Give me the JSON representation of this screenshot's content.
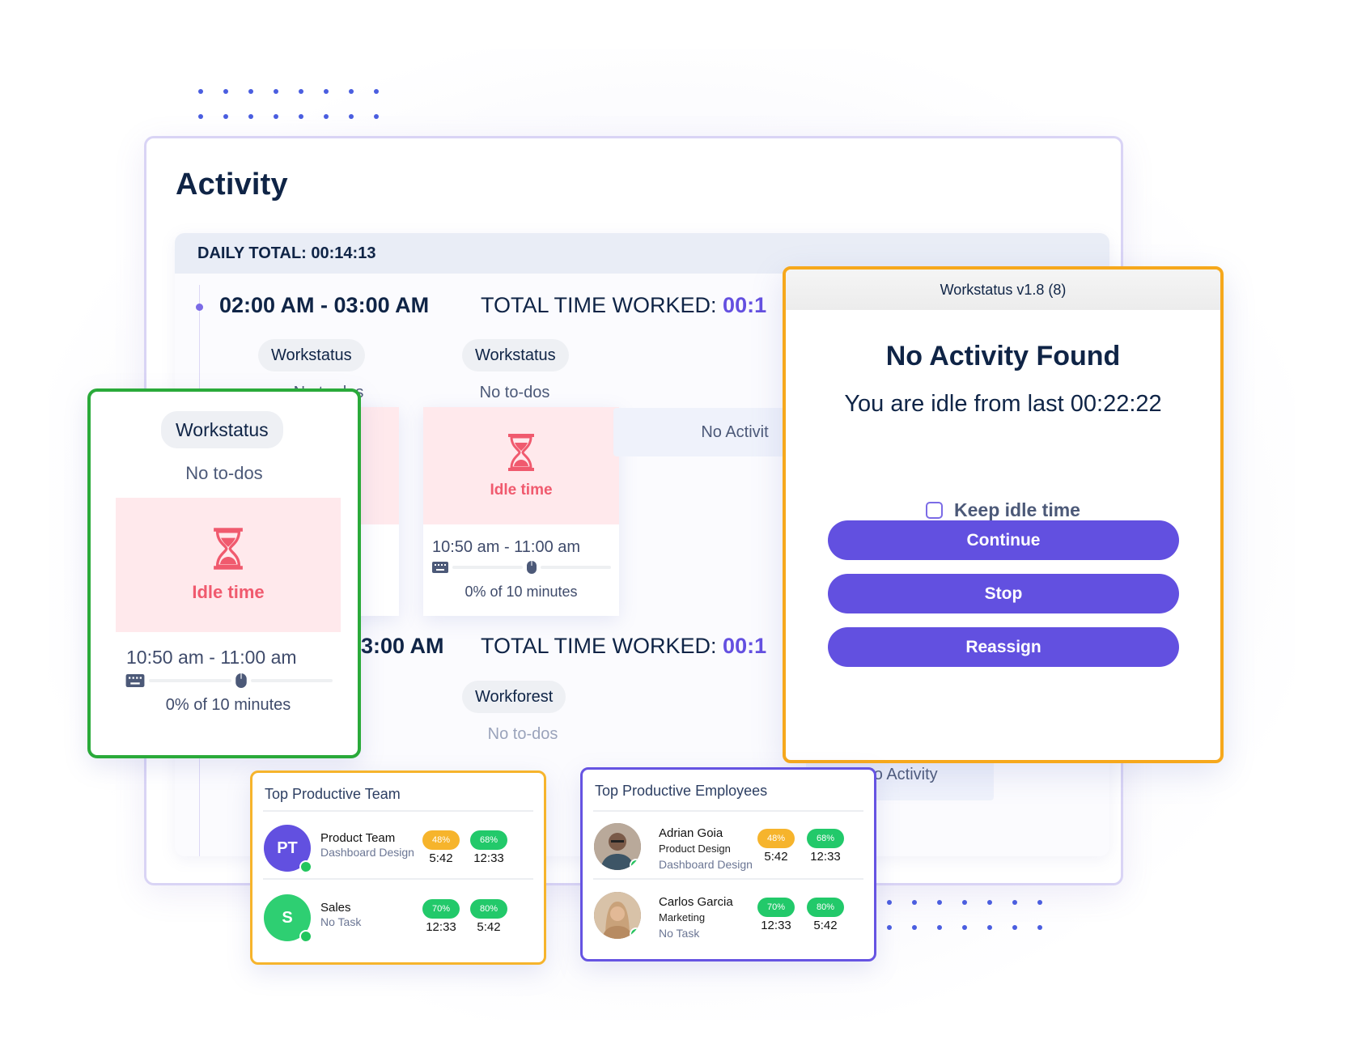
{
  "page": {
    "title": "Activity",
    "daily_total": "DAILY TOTAL: 00:14:13"
  },
  "hours": [
    {
      "range": "02:00 AM - 03:00 AM",
      "total_label": "TOTAL TIME WORKED:",
      "total_value": "00:1",
      "slots": [
        {
          "app": "Workstatus",
          "todos": "No to-dos",
          "status": "Idle time",
          "time": "10:50 am - 11:00 am",
          "activity_pct": "0% of 10 minutes"
        },
        {
          "app": "Workstatus",
          "todos": "No to-dos",
          "status": "Idle time",
          "time": "10:50 am - 11:00 am",
          "activity_pct": "0% of 10 minutes"
        },
        {
          "status": "No Activit"
        }
      ]
    },
    {
      "range": "3:00 AM",
      "total_label": "TOTAL TIME WORKED:",
      "total_value": "00:1",
      "slots": [
        {
          "app": "Workforest",
          "todos": "No to-dos"
        },
        {
          "status": "No Activity"
        }
      ]
    }
  ],
  "highlight_card": {
    "app": "Workstatus",
    "todos": "No to-dos",
    "status": "Idle time",
    "time": "10:50 am - 11:00 am",
    "activity_pct": "0% of 10 minutes",
    "keyboard_activity": 0,
    "mouse_activity": 0
  },
  "idle_dialog": {
    "window_title": "Workstatus v1.8 (8)",
    "heading": "No Activity Found",
    "message": "You are idle from last 00:22:22",
    "keep_idle_label": "Keep idle time",
    "keep_idle_checked": false,
    "buttons": {
      "continue": "Continue",
      "stop": "Stop",
      "reassign": "Reassign"
    }
  },
  "top_team": {
    "title": "Top Productive Team",
    "rows": [
      {
        "initials": "PT",
        "name": "Product Team",
        "task": "Dashboard Design",
        "online": true,
        "metrics": [
          {
            "badge": "48%",
            "value": "5:42",
            "color": "#f6b42c"
          },
          {
            "badge": "68%",
            "value": "12:33",
            "color": "#22c96a"
          }
        ]
      },
      {
        "initials": "S",
        "name": "Sales",
        "task": "No Task",
        "online": true,
        "metrics": [
          {
            "badge": "70%",
            "value": "12:33",
            "color": "#22c96a"
          },
          {
            "badge": "80%",
            "value": "5:42",
            "color": "#22c96a"
          }
        ]
      }
    ]
  },
  "top_employees": {
    "title": "Top Productive Employees",
    "rows": [
      {
        "name": "Adrian Goia",
        "department": "Product Design",
        "task": "Dashboard Design",
        "online": true,
        "metrics": [
          {
            "badge": "48%",
            "value": "5:42",
            "color": "#f6b42c"
          },
          {
            "badge": "68%",
            "value": "12:33",
            "color": "#22c96a"
          }
        ]
      },
      {
        "name": "Carlos Garcia",
        "department": "Marketing",
        "task": "No Task",
        "online": true,
        "metrics": [
          {
            "badge": "70%",
            "value": "12:33",
            "color": "#22c96a"
          },
          {
            "badge": "80%",
            "value": "5:42",
            "color": "#22c96a"
          }
        ]
      }
    ]
  },
  "colors": {
    "accent": "#6250e0",
    "idle": "#f05a6e",
    "highlight_green": "#2aaa3a",
    "highlight_orange": "#f6a81c",
    "highlight_purple": "#6654e2"
  }
}
